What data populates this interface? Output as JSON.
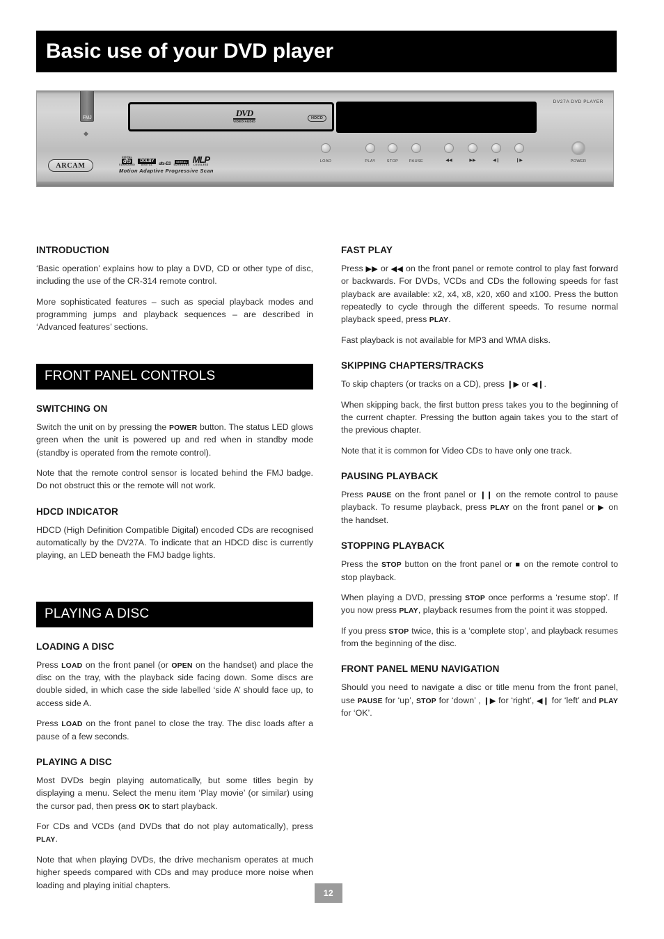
{
  "page": {
    "title": "Basic use of your DVD player",
    "number": "12"
  },
  "player_photo": {
    "model_label": "DV27A DVD PLAYER",
    "brand_logo": "ARCAM",
    "fmj_badge": "FMJ",
    "dvd_logo_word": "DVD",
    "dvd_logo_sub": "VIDEO/AUDIO",
    "hdcd_badge": "HDCD",
    "format_logos": [
      {
        "top": "DIGITAL",
        "mark": "dts",
        "bottom": "SURROUND"
      },
      {
        "top": "",
        "mark": "DOLBY",
        "bottom": "DIGITAL"
      },
      {
        "top": "",
        "mark": "dts-ES",
        "bottom": ""
      },
      {
        "top": "",
        "mark": "DIGITAL",
        "bottom": "SURROUND"
      },
      {
        "top": "",
        "mark": "MLP",
        "bottom": "LOSSLESS"
      }
    ],
    "tagline": "Motion Adaptive Progressive Scan",
    "buttons": [
      {
        "label": "LOAD",
        "glyph": ""
      },
      {
        "label": "PLAY",
        "glyph": ""
      },
      {
        "label": "STOP",
        "glyph": ""
      },
      {
        "label": "PAUSE",
        "glyph": ""
      },
      {
        "label": "",
        "glyph": "◀◀"
      },
      {
        "label": "",
        "glyph": "▶▶"
      },
      {
        "label": "",
        "glyph": "◀❙"
      },
      {
        "label": "",
        "glyph": "❙▶"
      },
      {
        "label": "POWER",
        "glyph": ""
      }
    ]
  },
  "left_column": {
    "introduction": {
      "heading": "INTRODUCTION",
      "p1_a": "‘Basic operation’ explains how to play a DVD, CD or other type of disc, including the use of the CR-314 remote control.",
      "p2": "More sophisticated features – such as special playback modes and programming jumps and playback sequences – are described in ‘Advanced features’ sections."
    },
    "front_panel_controls": {
      "section_heading": "FRONT PANEL CONTROLS",
      "switching_on": {
        "heading": "SWITCHING ON",
        "p1_a": "Switch the unit on by pressing the ",
        "p1_kw": "POWER",
        "p1_b": " button. The status LED glows green when the unit is powered up and red when in standby mode (standby is operated from the remote control).",
        "p2": "Note that the remote control sensor is located behind the FMJ badge. Do not obstruct this or the remote will not work."
      },
      "hdcd_indicator": {
        "heading": "HDCD INDICATOR",
        "p1": "HDCD (High Definition Compatible Digital) encoded CDs are recognised automatically by the DV27A. To indicate that an HDCD disc is currently playing, an LED beneath the FMJ badge lights."
      }
    },
    "playing_a_disc": {
      "section_heading": "PLAYING A DISC",
      "loading_a_disc": {
        "heading": "LOADING A DISC",
        "p1_a": "Press ",
        "p1_kw1": "LOAD",
        "p1_b": " on the front panel (or ",
        "p1_kw2": "OPEN",
        "p1_c": " on the handset) and place the disc on the tray, with the playback side facing down. Some discs are double sided, in which case the side labelled ‘side A’ should face up, to access side A.",
        "p2_a": "Press ",
        "p2_kw": "LOAD",
        "p2_b": " on the front panel to close the tray. The disc loads after a pause of a few seconds."
      },
      "playing_sub": {
        "heading": "PLAYING A DISC",
        "p1_a": "Most DVDs begin playing automatically, but some titles begin by displaying a menu. Select the menu item ‘Play movie’ (or similar) using the cursor pad, then press ",
        "p1_kw": "OK",
        "p1_b": " to start playback.",
        "p2_a": "For CDs and VCDs (and DVDs that do not play automatically), press ",
        "p2_kw": "PLAY",
        "p2_b": ".",
        "p3": "Note that when playing DVDs, the drive mechanism operates at much higher speeds compared with CDs and may produce more noise when loading and playing initial chapters."
      }
    }
  },
  "right_column": {
    "fast_play": {
      "heading": "FAST PLAY",
      "p1_a": "Press ",
      "p1_g1": "▶▶",
      "p1_b": " or ",
      "p1_g2": "◀◀",
      "p1_c": " on the front panel or remote control to play fast forward or backwards. For DVDs, VCDs and CDs the following speeds for fast playback are available: x2, x4, x8, x20, x60 and x100. Press the button repeatedly to cycle through the different speeds. To resume normal playback speed, press ",
      "p1_kw": "PLAY",
      "p1_d": ".",
      "p2": "Fast playback is not available for MP3 and WMA disks."
    },
    "skipping": {
      "heading": "SKIPPING CHAPTERS/TRACKS",
      "p1_a": "To skip chapters (or tracks on a CD), press ",
      "p1_g1": "❙▶",
      "p1_b": " or ",
      "p1_g2": "◀❙",
      "p1_c": ".",
      "p2": "When skipping back, the first button press takes you to the beginning of the current chapter. Pressing the button again takes you to the start of the previous chapter.",
      "p3": "Note that it is common for Video CDs to have only one track."
    },
    "pausing": {
      "heading": "PAUSING PLAYBACK",
      "p1_a": "Press ",
      "p1_kw1": "PAUSE",
      "p1_b": " on the front panel or ",
      "p1_g1": "❙❙",
      "p1_c": " on the remote control to pause playback. To resume playback, press ",
      "p1_kw2": "PLAY",
      "p1_d": " on the front panel or ",
      "p1_g2": "▶",
      "p1_e": " on the handset."
    },
    "stopping": {
      "heading": "STOPPING PLAYBACK",
      "p1_a": "Press the ",
      "p1_kw": "STOP",
      "p1_b": " button on the front panel or ",
      "p1_g": "■",
      "p1_c": " on the remote control to stop playback.",
      "p2_a": "When playing a DVD, pressing ",
      "p2_kw1": "STOP",
      "p2_b": " once performs a ‘resume stop’. If you now press ",
      "p2_kw2": "PLAY",
      "p2_c": ", playback resumes from the point it was stopped.",
      "p3_a": "If you press ",
      "p3_kw": "STOP",
      "p3_b": " twice, this is a ‘complete stop’, and playback resumes from the beginning of the disc."
    },
    "menu_navigation": {
      "heading": "FRONT PANEL MENU NAVIGATION",
      "p1_a": "Should you need to navigate a disc or title menu from the front panel, use ",
      "p1_kw1": "PAUSE",
      "p1_b": " for ‘up’, ",
      "p1_kw2": "STOP",
      "p1_c": " for ‘down’ , ",
      "p1_g1": "❙▶",
      "p1_d": " for ‘right’, ",
      "p1_g2": "◀❙",
      "p1_e": " for ‘left’ and ",
      "p1_kw3": "PLAY",
      "p1_f": " for ‘OK’."
    }
  }
}
